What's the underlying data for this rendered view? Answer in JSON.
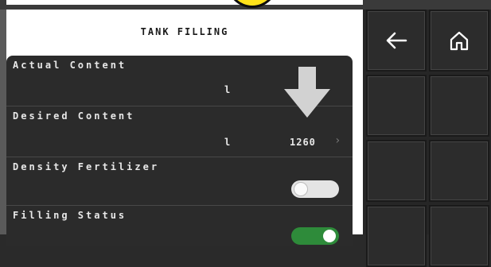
{
  "screen": {
    "title": "TANK FILLING"
  },
  "rows": [
    {
      "label": "Actual Content",
      "unit": "l",
      "value": ""
    },
    {
      "label": "Desired Content",
      "unit": "l",
      "value": "1260"
    },
    {
      "label": "Density Fertilizer",
      "toggle": "off"
    },
    {
      "label": "Filling Status",
      "toggle": "on"
    }
  ],
  "softkeys": [
    {
      "icon": "arrow-left-icon"
    },
    {
      "icon": "home-icon"
    },
    {
      "icon": ""
    },
    {
      "icon": ""
    },
    {
      "icon": ""
    },
    {
      "icon": ""
    },
    {
      "icon": ""
    },
    {
      "icon": ""
    }
  ],
  "colors": {
    "toggle_on": "#2e8b3a",
    "warning": "#ffe21a",
    "panel": "#2b2b2b"
  }
}
